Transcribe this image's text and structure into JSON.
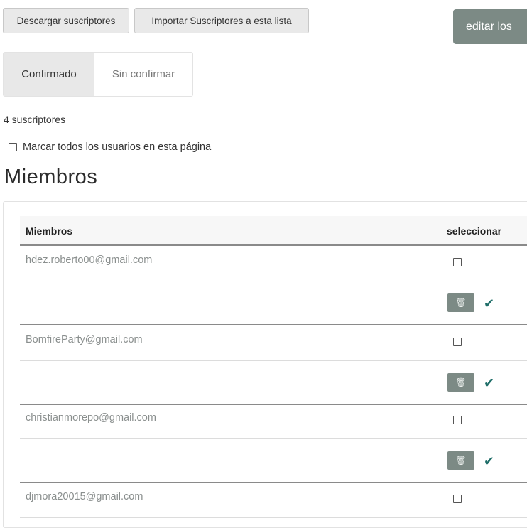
{
  "toolbar": {
    "download_label": "Descargar suscriptores",
    "import_label": "Importar Suscriptores a esta lista",
    "edit_label": "editar los"
  },
  "tabs": [
    {
      "label": "Confirmado",
      "active": true
    },
    {
      "label": "Sin confirmar",
      "active": false
    }
  ],
  "subscriber_count": "4 suscriptores",
  "mark_all_label": "Marcar todos los usuarios en esta página",
  "section_title": "Miembros",
  "table": {
    "headers": {
      "members": "Miembros",
      "select": "seleccionar"
    },
    "rows": [
      {
        "email": "hdez.roberto00@gmail.com"
      },
      {
        "email": "BomfireParty@gmail.com"
      },
      {
        "email": "christianmorepo@gmail.com"
      },
      {
        "email": "djmora20015@gmail.com"
      }
    ]
  },
  "icons": {
    "delete": "trash-icon",
    "confirm": "checkmark-icon"
  },
  "colors": {
    "accent": "#7c8a85",
    "check": "#1f6e69",
    "email_text": "#8a8f8e"
  }
}
